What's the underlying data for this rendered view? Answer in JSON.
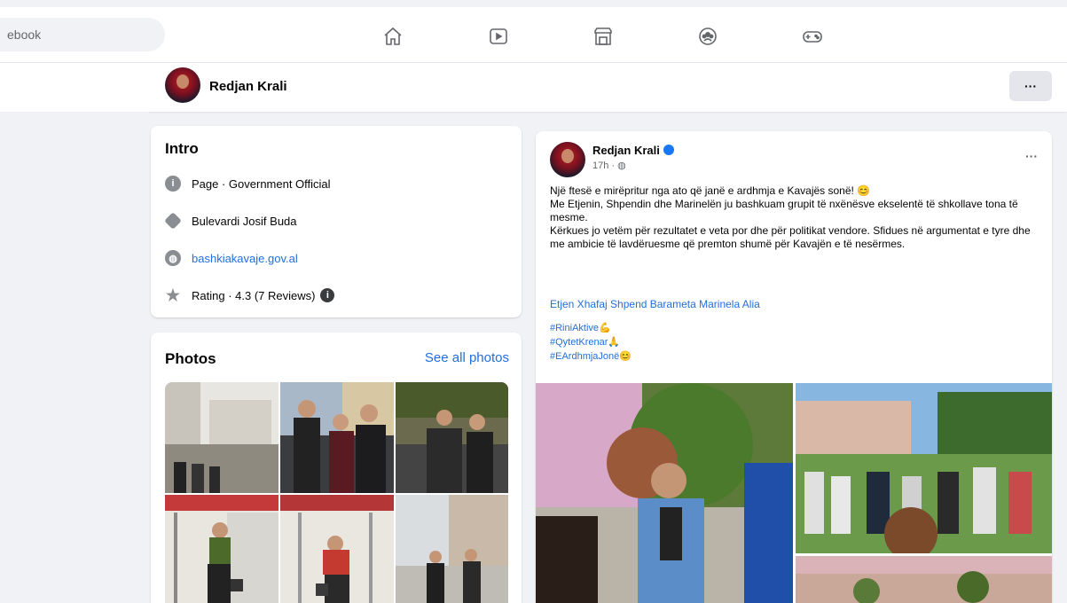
{
  "search": {
    "placeholder": "ebook"
  },
  "nav": {
    "icons": [
      "home-icon",
      "watch-icon",
      "marketplace-icon",
      "groups-icon",
      "gaming-icon"
    ]
  },
  "profile_bar": {
    "name": "Redjan Krali",
    "more_label": "···"
  },
  "intro": {
    "title": "Intro",
    "items": [
      {
        "icon": "info-icon",
        "text": "Page · Government Official"
      },
      {
        "icon": "location-icon",
        "text": "Bulevardi Josif Buda"
      },
      {
        "icon": "globe-icon",
        "text": "bashkiakavaje.gov.al"
      },
      {
        "icon": "star-icon",
        "text": "Rating · 4.3 (7 Reviews)"
      }
    ]
  },
  "photos": {
    "title": "Photos",
    "see_all": "See all photos"
  },
  "post": {
    "author": "Redjan Krali",
    "time": "17h · ",
    "more": "···",
    "lines": [
      "Një ftesë e mirëpritur nga ato që janë e ardhmja e Kavajës sonë! 😊",
      "Me Etjenin, Shpendin dhe Marinelën ju bashkuam grupit të nxënësve ekselentë të shkollave tona të mesme.",
      "Kërkues jo vetëm për rezultatet e veta por dhe për politikat vendore. Sfidues në argumentat e tyre dhe me ambicie të lavdëruesme që premton shumë për Kavajën e të nesërmes."
    ],
    "tags": "Etjen Xhafaj Shpend Barameta Marinela Alia",
    "hashtags": [
      "#RiniAktive💪",
      "#QytetKrenar🙏",
      "#EArdhmjaJonë😊"
    ]
  },
  "colors": {
    "link": "#216fdb",
    "background": "#f0f2f5",
    "card": "#ffffff"
  }
}
